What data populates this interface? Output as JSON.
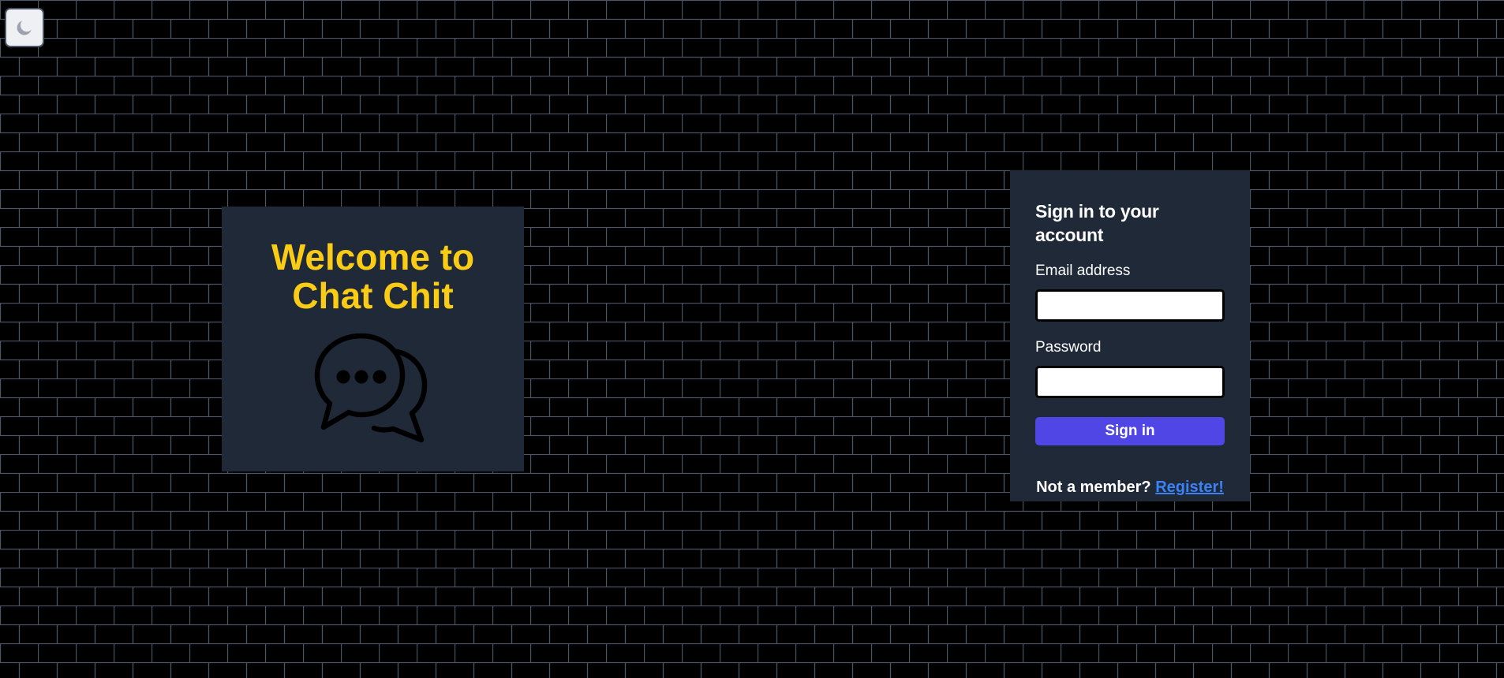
{
  "theme_toggle": {
    "icon": "moon-icon"
  },
  "welcome": {
    "title_line1": "Welcome to",
    "title_line2": "Chat Chit",
    "icon": "chat-bubbles-icon"
  },
  "login": {
    "title": "Sign in to your account",
    "email_label": "Email address",
    "email_value": "",
    "password_label": "Password",
    "password_value": "",
    "submit_label": "Sign in",
    "register_prompt": "Not a member?",
    "register_link": "Register!"
  },
  "colors": {
    "page_background": "#000000",
    "brick_mortar": "#4b5563",
    "card_background": "#1f2937",
    "title_accent": "#facc15",
    "primary_button": "#4f46e5",
    "link": "#3b82f6"
  }
}
